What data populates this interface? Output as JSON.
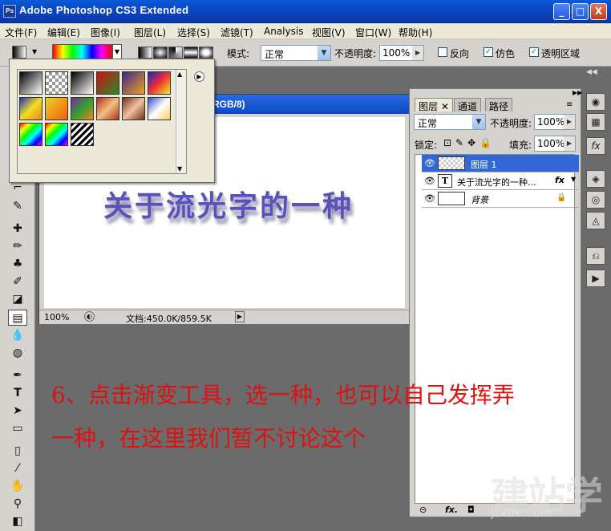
{
  "window": {
    "title": "Adobe Photoshop CS3 Extended",
    "logo": "Ps",
    "minimize": "_",
    "maximize": "□",
    "close": "X"
  },
  "menu": [
    "文件(F)",
    "编辑(E)",
    "图像(I)",
    "图层(L)",
    "选择(S)",
    "滤镜(T)",
    "Analysis",
    "视图(V)",
    "窗口(W)",
    "帮助(H)"
  ],
  "options": {
    "mode_label": "模式:",
    "mode_value": "正常",
    "opacity_label": "不透明度:",
    "opacity_value": "100%",
    "reverse_label": "反向",
    "dither_label": "仿色",
    "transparency_label": "透明区域",
    "reverse_checked": false,
    "dither_checked": true,
    "transparency_checked": true
  },
  "document": {
    "title_suffix": "RGB/8)",
    "canvas_text": "关于流光字的一种",
    "zoom": "100%",
    "doc_info": "文档:450.0K/859.5K"
  },
  "layers_panel": {
    "tabs": [
      "图层",
      "通道",
      "路径"
    ],
    "blend_mode": "正常",
    "opacity_label": "不透明度:",
    "opacity_value": "100%",
    "lock_label": "锁定:",
    "fill_label": "填充:",
    "fill_value": "100%",
    "layers": [
      {
        "name": "图层 1",
        "selected": true,
        "type": "raster"
      },
      {
        "name": "关于流光字的一种...",
        "selected": false,
        "type": "text",
        "fx": "fx"
      },
      {
        "name": "背景",
        "selected": false,
        "type": "background"
      }
    ],
    "text_layer_glyph": "T",
    "fx_footer": "fx."
  },
  "caption": {
    "line1": "6、点击渐变工具，选一种，也可以自己发挥弄",
    "line2": "一种，在这里我们暂不讨论这个"
  },
  "watermark": {
    "big": "建站学",
    "small": "jzxue.com"
  },
  "colors": {
    "titlebar": "#0b47c6",
    "caption": "#e01010",
    "selection": "#3168d5"
  }
}
